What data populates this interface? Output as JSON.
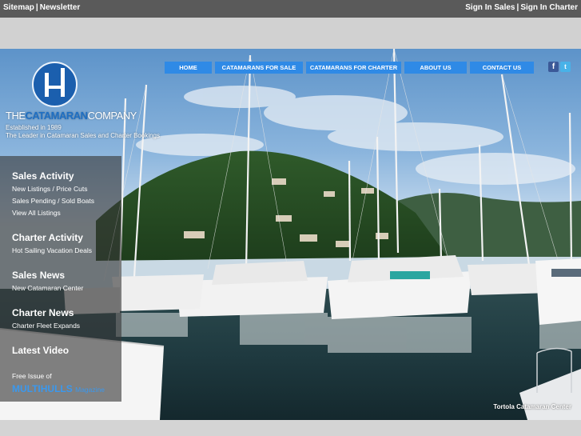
{
  "topbar": {
    "left_links": [
      "Sitemap",
      "Newsletter"
    ],
    "right_links": [
      "Sign In Sales",
      "Sign In Charter"
    ],
    "separator": "|"
  },
  "nav": {
    "items": [
      {
        "label": "HOME"
      },
      {
        "label": "CATAMARANS FOR SALE"
      },
      {
        "label": "CATAMARANS FOR CHARTER"
      },
      {
        "label": "ABOUT US"
      },
      {
        "label": "CONTACT US"
      }
    ],
    "color": "#2f8ae6",
    "social": [
      {
        "icon": "facebook-icon",
        "glyph": "f"
      },
      {
        "icon": "twitter-icon",
        "glyph": "t"
      }
    ]
  },
  "logo": {
    "name_prefix": "THE",
    "name_highlight": "CATAMARAN",
    "name_suffix": "COMPANY",
    "established": "Established in 1989",
    "tagline": "The Leader in Catamaran Sales and Charter Bookings"
  },
  "sidebar": {
    "sections": [
      {
        "heading": "Sales Activity",
        "links": [
          "New Listings / Price Cuts",
          "Sales Pending / Sold Boats",
          "View All Listings"
        ]
      },
      {
        "heading": "Charter Activity",
        "links": [
          "Hot Sailing Vacation Deals"
        ]
      },
      {
        "heading": "Sales News",
        "links": [
          "New Catamaran Center"
        ]
      },
      {
        "heading": "Charter News",
        "links": [
          "Charter Fleet Expands"
        ]
      },
      {
        "heading": "Latest Video",
        "links": []
      }
    ],
    "promo": {
      "free_issue": "Free Issue of",
      "magazine_name": "MULTIHULLS",
      "magazine_word": "Magazine"
    }
  },
  "hero": {
    "caption": "Tortola Catamaran Center"
  }
}
